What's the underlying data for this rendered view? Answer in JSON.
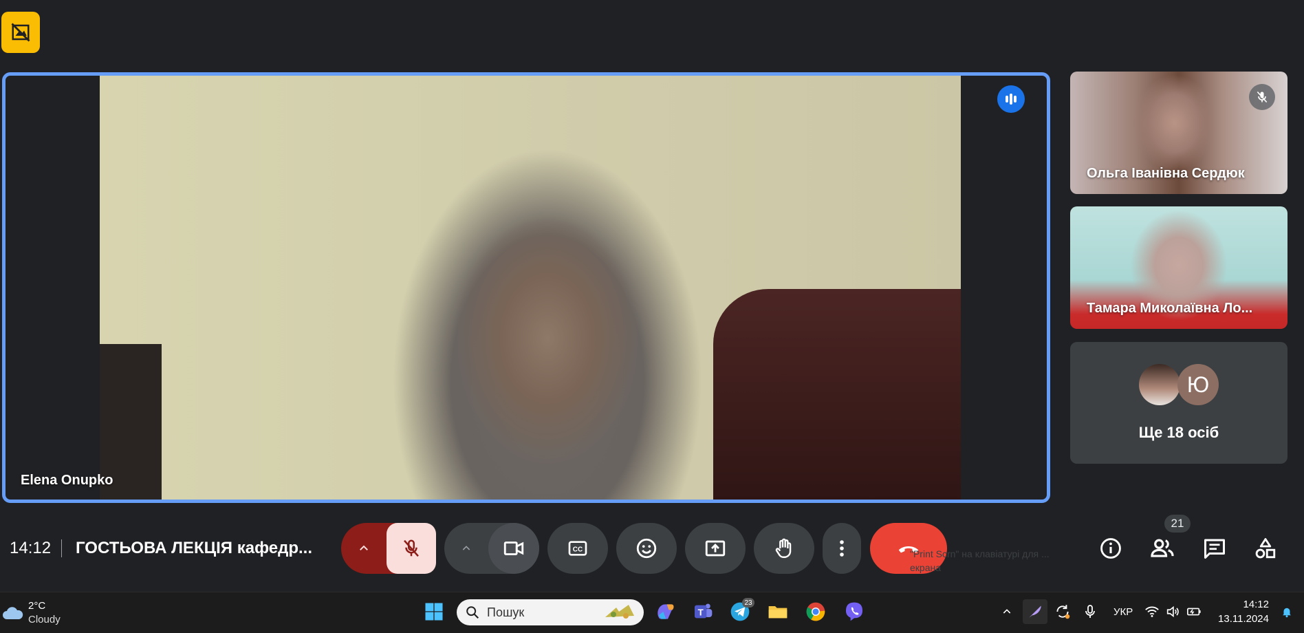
{
  "main_speaker": {
    "name": "Elena Onupko"
  },
  "participants": [
    {
      "name": "Ольга Іванівна Сердюк"
    },
    {
      "name": "Тамара Миколаївна Ло..."
    }
  ],
  "others": {
    "avatar_letter": "Ю",
    "label": "Ще 18 осіб"
  },
  "meeting": {
    "time": "14:12",
    "title": "ГОСТЬОВА ЛЕКЦІЯ кафедр...",
    "participants_count": "21"
  },
  "hint": {
    "line1": "\"Print Scrn\" на клавіатурі для ...",
    "line2": "екрана"
  },
  "taskbar": {
    "weather_temp": "2°C",
    "weather_desc": "Cloudy",
    "search_placeholder": "Пошук",
    "telegram_badge": "23",
    "language": "УКР",
    "time": "14:12",
    "date": "13.11.2024"
  },
  "colors": {
    "accent_blue": "#669df6",
    "end_call_red": "#ea4335",
    "mic_off_bg": "#f9dedc",
    "badge_yellow": "#fbbc04"
  }
}
